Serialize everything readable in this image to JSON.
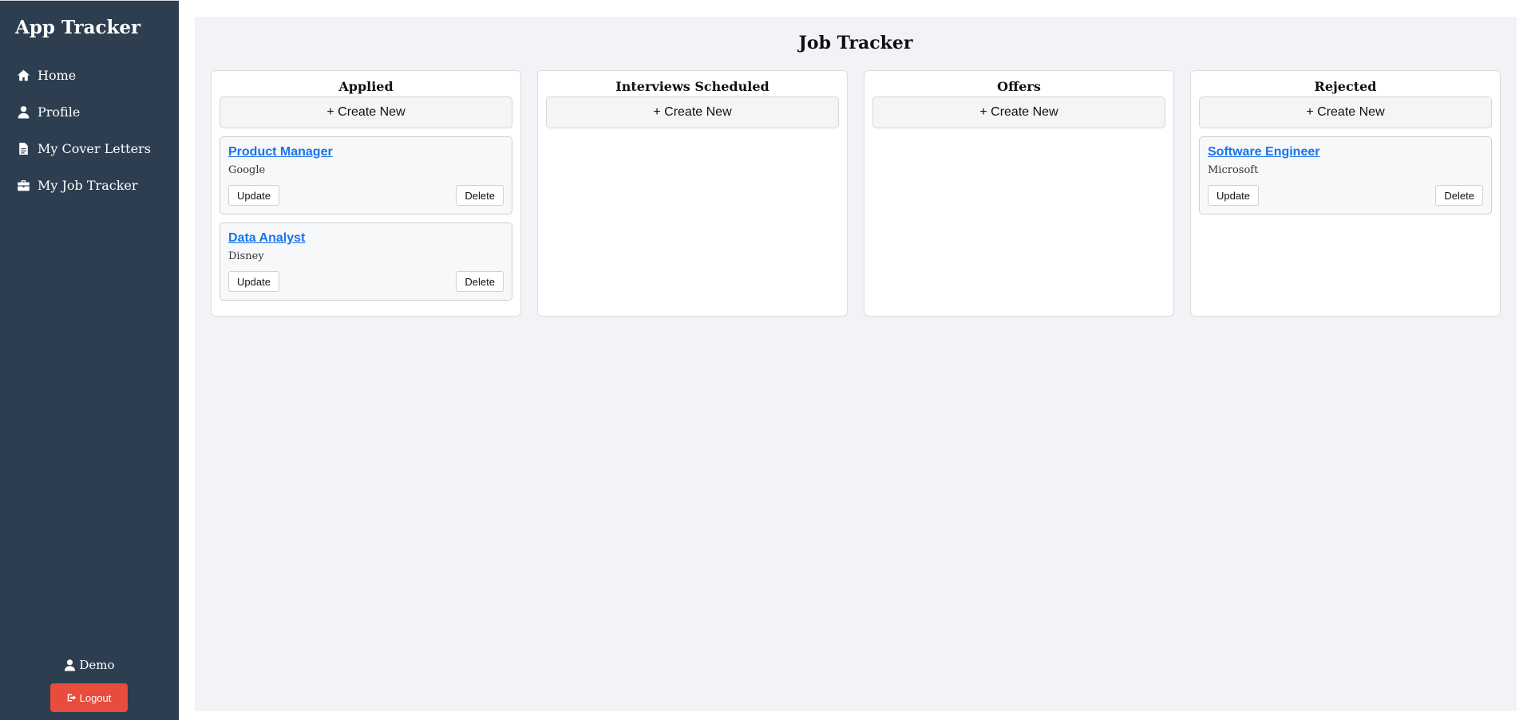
{
  "sidebar": {
    "brand": "App Tracker",
    "items": [
      {
        "label": "Home",
        "icon": "home-icon"
      },
      {
        "label": "Profile",
        "icon": "user-icon"
      },
      {
        "label": "My Cover Letters",
        "icon": "file-icon"
      },
      {
        "label": "My Job Tracker",
        "icon": "briefcase-icon"
      }
    ],
    "user_name": "Demo",
    "logout_label": "Logout"
  },
  "main": {
    "title": "Job Tracker",
    "create_label": "+ Create New",
    "update_label": "Update",
    "delete_label": "Delete",
    "columns": [
      {
        "title": "Applied",
        "jobs": [
          {
            "title": "Product Manager",
            "company": "Google"
          },
          {
            "title": "Data Analyst",
            "company": "Disney"
          }
        ]
      },
      {
        "title": "Interviews Scheduled",
        "jobs": []
      },
      {
        "title": "Offers",
        "jobs": []
      },
      {
        "title": "Rejected",
        "jobs": [
          {
            "title": "Software Engineer",
            "company": "Microsoft"
          }
        ]
      }
    ]
  },
  "colors": {
    "sidebar_bg": "#2c3e50",
    "logout_bg": "#e74c3c",
    "link": "#1a73e8",
    "main_bg": "#f3f3f7"
  }
}
